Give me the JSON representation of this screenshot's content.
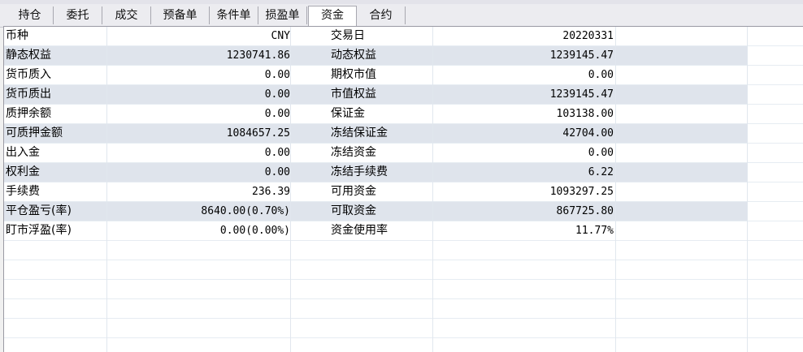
{
  "tabs": [
    {
      "label": "持仓",
      "active": false
    },
    {
      "label": "委托",
      "active": false
    },
    {
      "label": "成交",
      "active": false
    },
    {
      "label": "预备单",
      "active": false
    },
    {
      "label": "条件单",
      "active": false
    },
    {
      "label": "损盈单",
      "active": false
    },
    {
      "label": "资金",
      "active": true
    },
    {
      "label": "合约",
      "active": false
    }
  ],
  "funds": {
    "rows": [
      {
        "label1": "币种",
        "value1": "CNY",
        "label2": "交易日",
        "value2": "20220331"
      },
      {
        "label1": "静态权益",
        "value1": "1230741.86",
        "label2": "动态权益",
        "value2": "1239145.47"
      },
      {
        "label1": "货币质入",
        "value1": "0.00",
        "label2": "期权市值",
        "value2": "0.00"
      },
      {
        "label1": "货币质出",
        "value1": "0.00",
        "label2": "市值权益",
        "value2": "1239145.47"
      },
      {
        "label1": "质押余额",
        "value1": "0.00",
        "label2": "保证金",
        "value2": "103138.00"
      },
      {
        "label1": "可质押金额",
        "value1": "1084657.25",
        "label2": "冻结保证金",
        "value2": "42704.00"
      },
      {
        "label1": "出入金",
        "value1": "0.00",
        "label2": "冻结资金",
        "value2": "0.00"
      },
      {
        "label1": "权利金",
        "value1": "0.00",
        "label2": "冻结手续费",
        "value2": "6.22"
      },
      {
        "label1": "手续费",
        "value1": "236.39",
        "label2": "可用资金",
        "value2": "1093297.25"
      },
      {
        "label1": "平仓盈亏(率)",
        "value1": "8640.00(0.70%)",
        "label2": "可取资金",
        "value2": "867725.80"
      },
      {
        "label1": "盯市浮盈(率)",
        "value1": "0.00(0.00%)",
        "label2": "资金使用率",
        "value2": "11.77%"
      }
    ]
  }
}
